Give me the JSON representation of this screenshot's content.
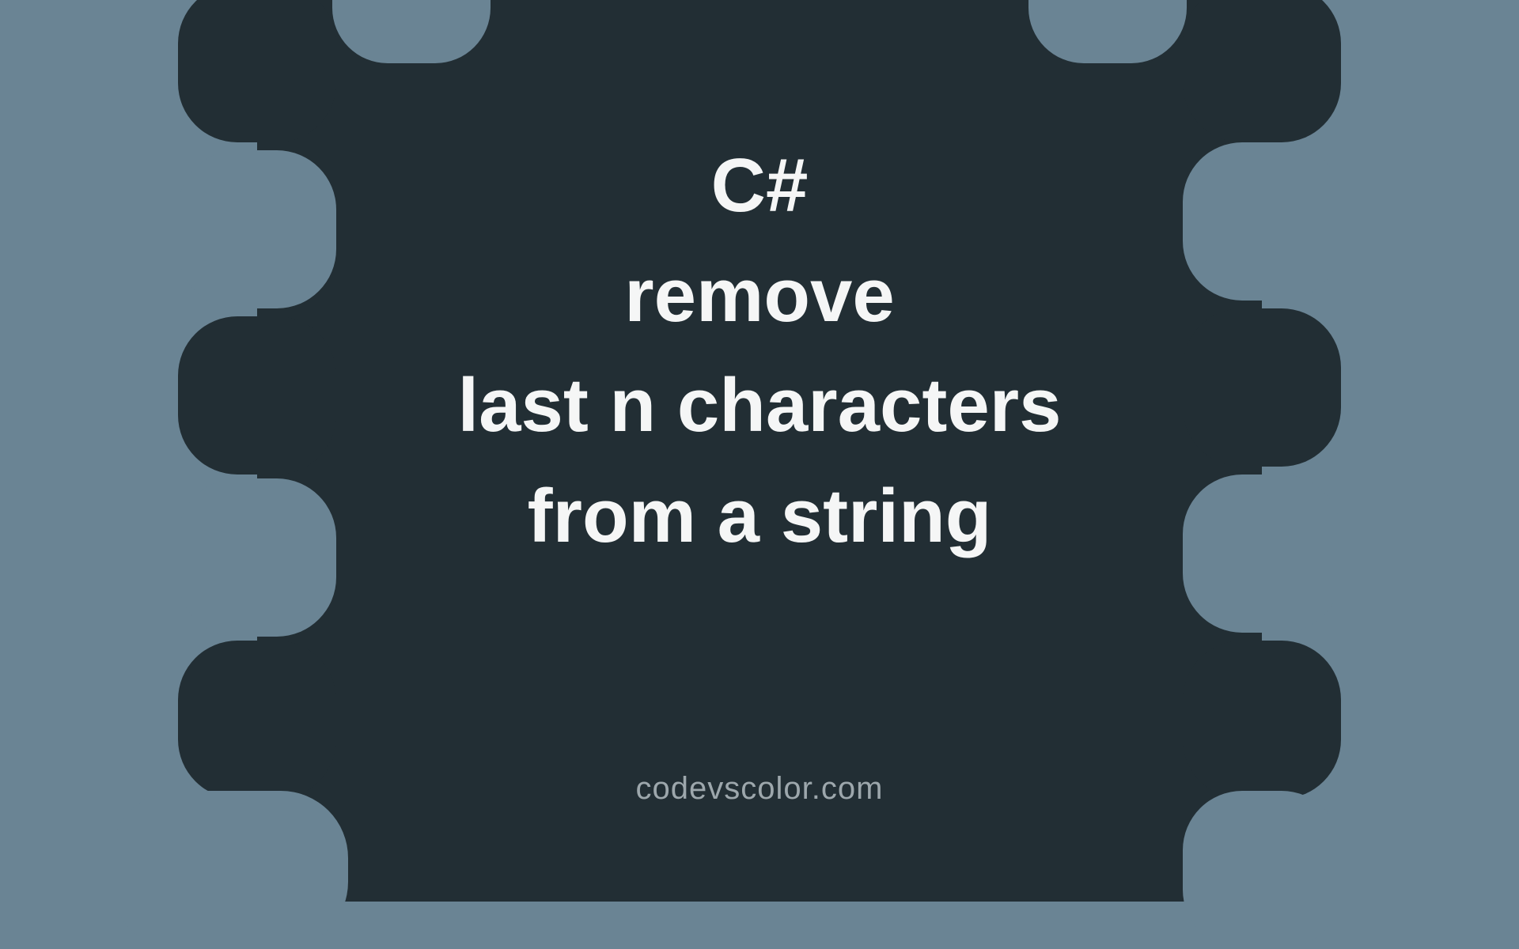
{
  "title": {
    "line1": "C#",
    "line2": "remove",
    "line3": "last n characters",
    "line4": "from a string"
  },
  "credit": "codevscolor.com",
  "colors": {
    "background": "#6A8494",
    "blob": "#222E34",
    "text": "#F5F6F6",
    "credit": "#9DA7AC"
  }
}
